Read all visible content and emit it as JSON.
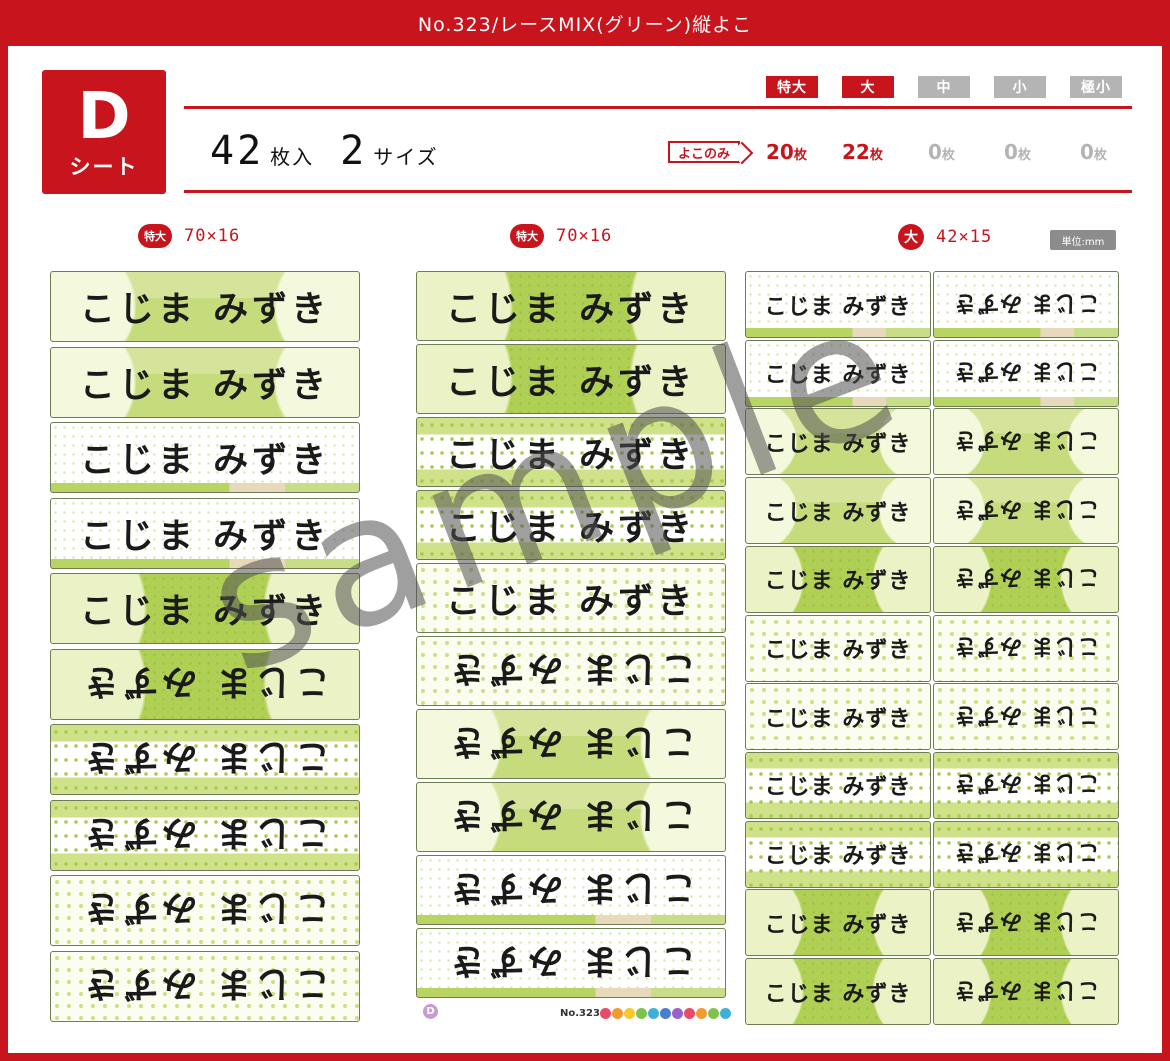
{
  "header": {
    "title": "No.323/レースMIX(グリーン)縦よこ"
  },
  "sheet": {
    "letter": "D",
    "sub": "シート"
  },
  "summary": {
    "count": "42",
    "count_unit": "枚入",
    "sizes": "2",
    "sizes_unit": "サイズ"
  },
  "size_tags": [
    {
      "label": "特大",
      "active": true
    },
    {
      "label": "大",
      "active": true
    },
    {
      "label": "中",
      "active": false
    },
    {
      "label": "小",
      "active": false
    },
    {
      "label": "極小",
      "active": false
    }
  ],
  "yoko_label": "よこのみ",
  "quantities": [
    {
      "value": "20",
      "unit": "枚"
    },
    {
      "value": "22",
      "unit": "枚"
    },
    {
      "value": "0",
      "unit": "枚"
    },
    {
      "value": "0",
      "unit": "枚"
    },
    {
      "value": "0",
      "unit": "枚"
    }
  ],
  "columns": [
    {
      "badge": "特大",
      "dimension": "70×16"
    },
    {
      "badge": "特大",
      "dimension": "70×16"
    },
    {
      "badge": "大",
      "dimension": "42×15"
    }
  ],
  "unit_note": "単位:mm",
  "label_name": "こじま みずき",
  "footer": {
    "badge": "D",
    "number": "No.323"
  },
  "watermark": "sample",
  "colors": {
    "accent": "#c8141c",
    "label_green": "#b4d15a"
  }
}
